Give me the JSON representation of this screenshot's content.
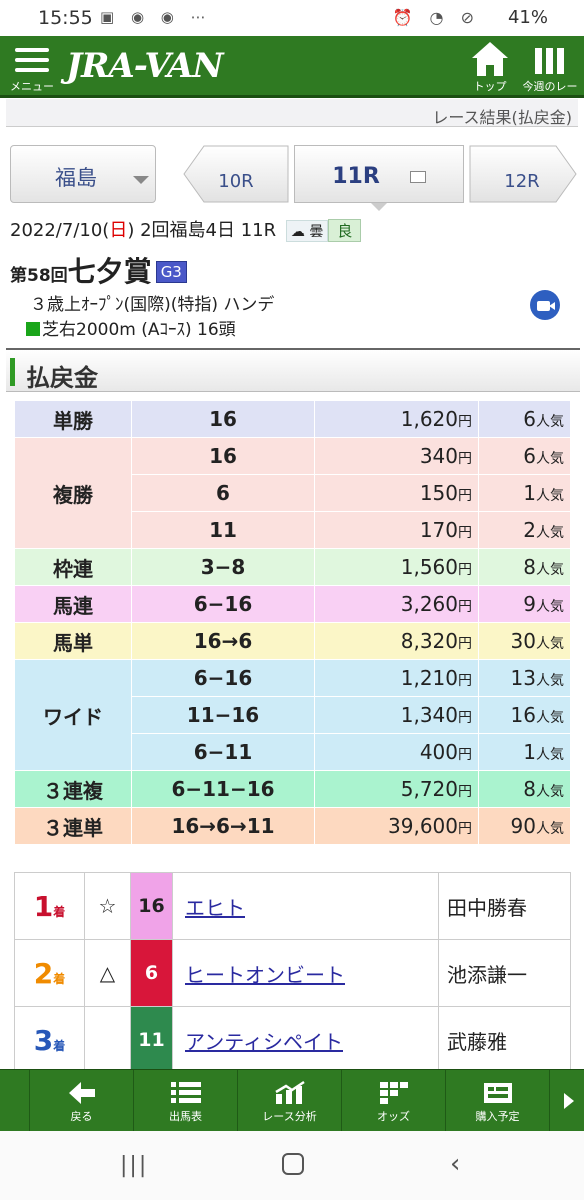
{
  "status": {
    "time": "15:55",
    "battery": "41%"
  },
  "appbar": {
    "menu_label": "メニュー",
    "logo": "JRA-VAN",
    "top_label": "トップ",
    "week_label": "今週のレース"
  },
  "page_header": "レース結果(払戻金)",
  "race_nav": {
    "venue": "福島",
    "prev": "10R",
    "current": "11R",
    "next": "12R"
  },
  "race_info": {
    "date_prefix": "2022/7/10(",
    "date_day": "日",
    "date_suffix": ")",
    "meeting": "2回福島4日 11R",
    "weather": "曇",
    "going": "良",
    "race_number": "第58回",
    "race_name": "七夕賞",
    "grade": "G3",
    "conditions": "３歳上ｵｰﾌﾟﾝ(国際)(特指) ハンデ",
    "course": "芝右2000m (Aｺｰｽ) 16頭"
  },
  "section_title": "払戻金",
  "payouts": {
    "yen": "円",
    "pop": "人気",
    "tansho": {
      "label": "単勝",
      "rows": [
        {
          "comb": "16",
          "amount": "1,620",
          "rank": "6"
        }
      ]
    },
    "fukusho": {
      "label": "複勝",
      "rows": [
        {
          "comb": "16",
          "amount": "340",
          "rank": "6"
        },
        {
          "comb": "6",
          "amount": "150",
          "rank": "1"
        },
        {
          "comb": "11",
          "amount": "170",
          "rank": "2"
        }
      ]
    },
    "wakuren": {
      "label": "枠連",
      "rows": [
        {
          "comb": "3−8",
          "amount": "1,560",
          "rank": "8"
        }
      ]
    },
    "umaren": {
      "label": "馬連",
      "rows": [
        {
          "comb": "6−16",
          "amount": "3,260",
          "rank": "9"
        }
      ]
    },
    "umatan": {
      "label": "馬単",
      "rows": [
        {
          "comb": "16→6",
          "amount": "8,320",
          "rank": "30"
        }
      ]
    },
    "wide": {
      "label": "ワイド",
      "rows": [
        {
          "comb": "6−16",
          "amount": "1,210",
          "rank": "13"
        },
        {
          "comb": "11−16",
          "amount": "1,340",
          "rank": "16"
        },
        {
          "comb": "6−11",
          "amount": "400",
          "rank": "1"
        }
      ]
    },
    "sanrenpuku": {
      "label": "３連複",
      "rows": [
        {
          "comb": "6−11−16",
          "amount": "5,720",
          "rank": "8"
        }
      ]
    },
    "sanrentan": {
      "label": "３連単",
      "rows": [
        {
          "comb": "16→6→11",
          "amount": "39,600",
          "rank": "90"
        }
      ]
    }
  },
  "results": {
    "place_suffix": "着",
    "rows": [
      {
        "place": "1",
        "mark": "☆",
        "num": "16",
        "horse": "エヒト",
        "jockey": "田中勝春",
        "num_color": "#f0a3e8",
        "num_text": "#222222"
      },
      {
        "place": "2",
        "mark": "△",
        "num": "6",
        "horse": "ヒートオンビート",
        "jockey": "池添謙一",
        "num_color": "#d8163a",
        "num_text": "#ffffff"
      },
      {
        "place": "3",
        "mark": "",
        "num": "11",
        "horse": "アンティシペイト",
        "jockey": "武藤雅",
        "num_color": "#2e8a4e",
        "num_text": "#ffffff"
      }
    ]
  },
  "bottom_nav": {
    "back": "戻る",
    "entries": "出馬表",
    "analysis": "レース分析",
    "odds": "オッズ",
    "plan": "購入予定"
  }
}
